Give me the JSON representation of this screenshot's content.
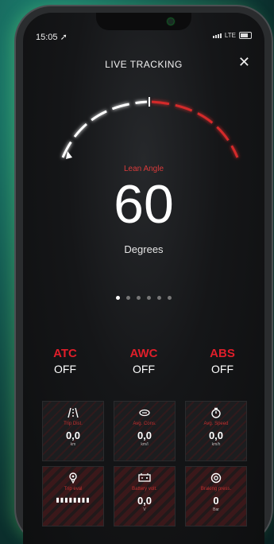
{
  "status": {
    "time": "15:05",
    "network": "LTE"
  },
  "header": {
    "title": "LIVE TRACKING",
    "close_icon": "close-icon"
  },
  "gauge": {
    "label": "Lean Angle",
    "value": "60",
    "unit": "Degrees",
    "left_color": "#ffffff",
    "right_color": "#d42a2a"
  },
  "pager": {
    "count": 6,
    "active": 0
  },
  "modes": [
    {
      "name": "ATC",
      "state": "OFF"
    },
    {
      "name": "AWC",
      "state": "OFF"
    },
    {
      "name": "ABS",
      "state": "OFF"
    }
  ],
  "cards": [
    {
      "icon": "road-icon",
      "label": "Trip Dist.",
      "value": "0,0",
      "unit": "km"
    },
    {
      "icon": "fuel-consumption-icon",
      "label": "Avg. Cons.",
      "value": "0,0",
      "unit": "km/l"
    },
    {
      "icon": "stopwatch-icon",
      "label": "Avg. Speed",
      "value": "0,0",
      "unit": "km/h"
    },
    {
      "icon": "location-pin-icon",
      "label": "Trip eval",
      "value": "",
      "trip": "▮▮▮▮▮▮▮▮",
      "unit": ""
    },
    {
      "icon": "battery-icon",
      "label": "Battery volt.",
      "value": "0,0",
      "unit": "V"
    },
    {
      "icon": "brake-icon",
      "label": "Braking press.",
      "value": "0",
      "unit": "Bar"
    }
  ],
  "accent": "#e01e2a"
}
